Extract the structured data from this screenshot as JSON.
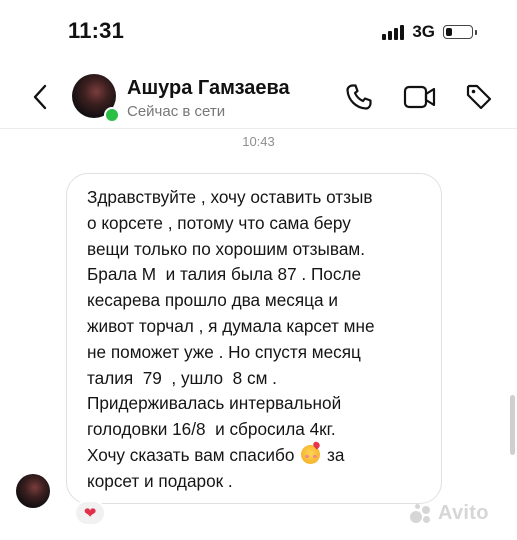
{
  "status_bar": {
    "time": "11:31",
    "network": "3G",
    "battery_level": 0.25
  },
  "header": {
    "contact_name": "Ашура Гамзаева",
    "contact_status": "Сейчас в сети",
    "online": true
  },
  "chat": {
    "timestamp": "10:43",
    "message": {
      "lines": [
        "Здравствуйте , хочу оставить отзыв",
        "о корсете , потому что сама беру",
        "вещи только по хорошим отзывам.",
        "Брала М  и талия была 87 . После",
        "кесарева прошло два месяца и",
        "живот торчал , я думала карсет мне",
        "не поможет уже . Но спустя месяц",
        "талия  79  , ушло  8 см .",
        "Придерживалась интервальной",
        "голодовки 16/8  и сбросила 4кг."
      ],
      "line_11_before_emoji": "Хочу сказать вам спасибо",
      "line_11_after_emoji": " за",
      "line_12": "корсет и подарок .",
      "emoji": "smiling-face-with-hearts-emoji"
    },
    "reaction": "❤"
  },
  "watermark": {
    "text": "Avito"
  },
  "colors": {
    "online": "#2bbf45",
    "bubble_border": "#e0e0e0",
    "reaction_heart": "#e0304a",
    "muted_text": "#777777"
  }
}
